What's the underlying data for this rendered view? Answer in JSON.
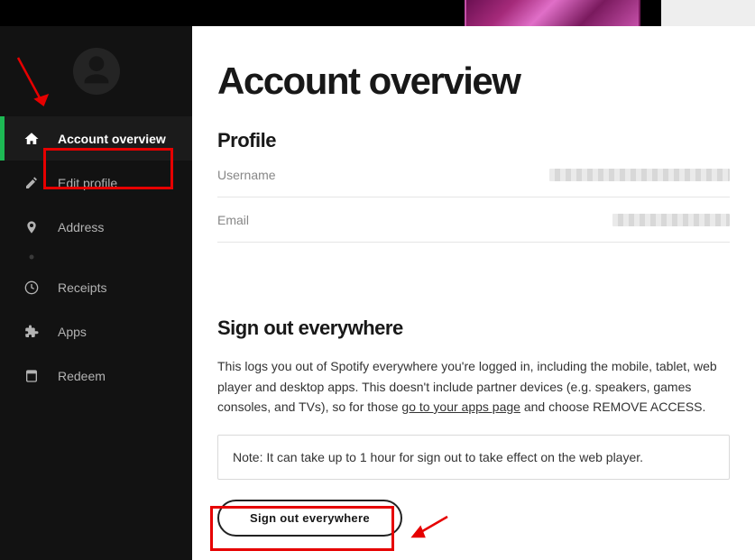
{
  "page": {
    "title": "Account overview"
  },
  "sidebar": {
    "items": [
      {
        "label": "Account overview",
        "icon": "home",
        "active": true
      },
      {
        "label": "Edit profile",
        "icon": "pencil"
      },
      {
        "label": "Address",
        "icon": "map-pin"
      },
      {
        "label": "",
        "icon": "dot",
        "obscured": true
      },
      {
        "label": "Receipts",
        "icon": "clock"
      },
      {
        "label": "Apps",
        "icon": "puzzle"
      },
      {
        "label": "Redeem",
        "icon": "card"
      }
    ]
  },
  "profile": {
    "heading": "Profile",
    "fields": [
      {
        "label": "Username"
      },
      {
        "label": "Email"
      }
    ]
  },
  "signout": {
    "heading": "Sign out everywhere",
    "body_before": "This logs you out of Spotify everywhere you're logged in, including the mobile, tablet, web player and desktop apps. This doesn't include partner devices (e.g. speakers, games consoles, and TVs), so for those ",
    "link_text": "go to your apps page",
    "body_after": " and choose REMOVE ACCESS.",
    "note": "Note: It can take up to 1 hour for sign out to take effect on the web player.",
    "button": "Sign out everywhere"
  }
}
